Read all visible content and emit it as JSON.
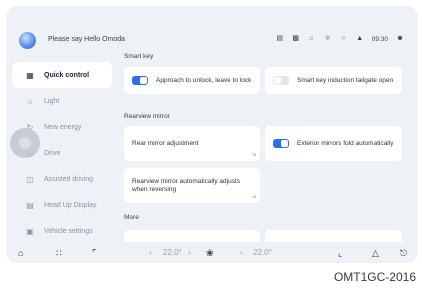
{
  "header": {
    "voice_prompt": "Please say Hello Omoda",
    "status_icons": [
      "parking-icon",
      "message-icon",
      "volume-icon",
      "bluetooth-icon",
      "wifi-icon",
      "signal-icon",
      "user-icon"
    ],
    "clock": "09:30"
  },
  "sidebar": {
    "items": [
      {
        "label": "Quick control",
        "icon": "grid-icon",
        "active": true
      },
      {
        "label": "Light",
        "icon": "bulb-icon",
        "active": false
      },
      {
        "label": "New energy",
        "icon": "energy-icon",
        "active": false
      },
      {
        "label": "Drive",
        "icon": "steering-icon",
        "active": false
      },
      {
        "label": "Assisted driving",
        "icon": "assist-icon",
        "active": false
      },
      {
        "label": "Head Up Display",
        "icon": "hud-icon",
        "active": false
      },
      {
        "label": "Vehicle settings",
        "icon": "car-icon",
        "active": false
      }
    ]
  },
  "main": {
    "sections": {
      "smart_key": "Smart key",
      "rearview_mirror": "Rearview mirror",
      "more": "More"
    },
    "cards": {
      "approach_unlock": {
        "label": "Approach to unlock, leave to lock",
        "toggle": "on"
      },
      "smart_key_tailgate": {
        "label": "Smart key induction tailgate open",
        "toggle": "off"
      },
      "rear_mirror_adjust": {
        "label": "Rear mirror adjustment"
      },
      "exterior_mirrors_fold": {
        "label": "Exterior mirrors fold automatically",
        "toggle": "on"
      },
      "rearview_reverse": {
        "label": "Rearview mirror automatically adjusts when reversing"
      }
    }
  },
  "bottom_bar": {
    "temp_left": "22.0°",
    "temp_right": "22.0°"
  },
  "caption": "OMT1GC-2016",
  "colors": {
    "accent": "#2f6fe4",
    "background": "#eef1f6",
    "card": "#ffffff"
  }
}
